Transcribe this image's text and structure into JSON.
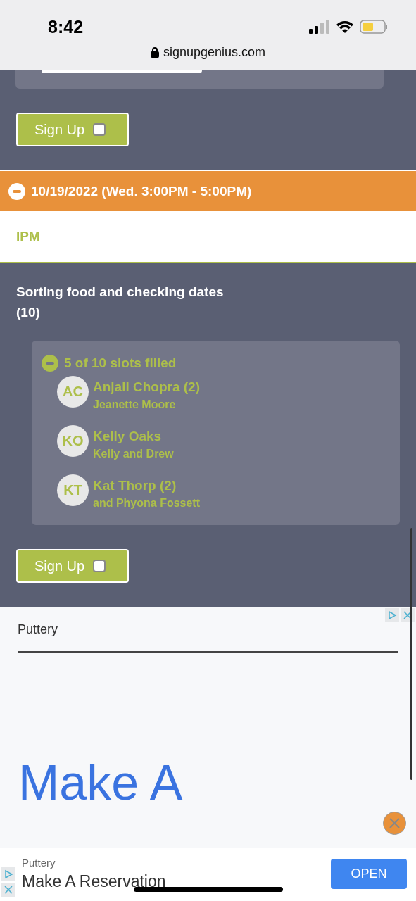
{
  "status_bar": {
    "time": "8:42",
    "url": "signupgenius.com"
  },
  "top_sign_up": {
    "label": "Sign Up",
    "checked": false
  },
  "date_header": {
    "text": "10/19/2022 (Wed. 3:00PM - 5:00PM)",
    "expanded": true
  },
  "location": "IPM",
  "slot": {
    "title": "Sorting food and checking dates (10)",
    "filled_summary": "5 of 10 slots filled",
    "expanded": true,
    "participants": [
      {
        "initials": "AC",
        "name": "Anjali Chopra (2)",
        "note": "Jeanette Moore"
      },
      {
        "initials": "KO",
        "name": "Kelly Oaks",
        "note": "Kelly and Drew"
      },
      {
        "initials": "KT",
        "name": "Kat Thorp (2)",
        "note": "and Phyona Fossett"
      }
    ],
    "sign_up": {
      "label": "Sign Up",
      "checked": false
    }
  },
  "ad": {
    "brand": "Puttery",
    "headline": "Make A"
  },
  "ad_banner": {
    "brand": "Puttery",
    "title": "Make A Reservation",
    "button": "OPEN"
  }
}
